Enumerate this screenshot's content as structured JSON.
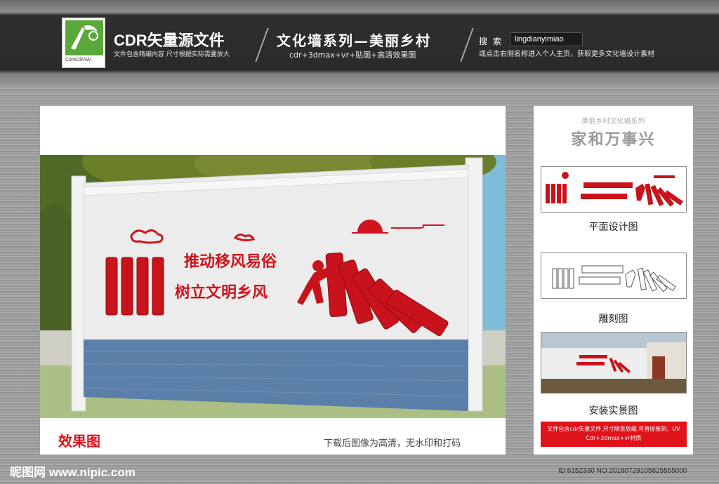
{
  "header": {
    "logo_caption": "CoreDRAW",
    "brand_title": "CDR矢量源文件",
    "brand_sub": "文件包含精编内容 尺寸根据实际需要放大",
    "series_title": "文化墙系列—美丽乡村",
    "series_sub": "cdr+3dmax+vr+贴图+高清效果图",
    "search_label": "搜索",
    "search_value": "lingdianyimiao",
    "search_hint": "或点击右侧名称进入个人主页，获取更多文化墙设计素材"
  },
  "main": {
    "slogan_line1": "推动移风易俗",
    "slogan_line2": "树立文明乡风",
    "label": "效果图",
    "note": "下载后图像为高清，无水印和打码"
  },
  "side": {
    "series_small": "美丽乡村文化墙系列",
    "series_big": "家和万事兴",
    "captions": [
      "平面设计图",
      "雕刻图",
      "安装实景图"
    ],
    "notice": "文件包含cdr矢量文件,尺寸随意放缩,可直接推刻、UV Cdr+3dmax+vr材质"
  },
  "footer": {
    "site": "昵图网 www.nipic.com",
    "id_line": "ID:6152330 NO:20180729105825555000"
  },
  "colors": {
    "accent_red": "#cf1420",
    "wall": "#e9e9e9",
    "brick": "#5a7fa8"
  }
}
